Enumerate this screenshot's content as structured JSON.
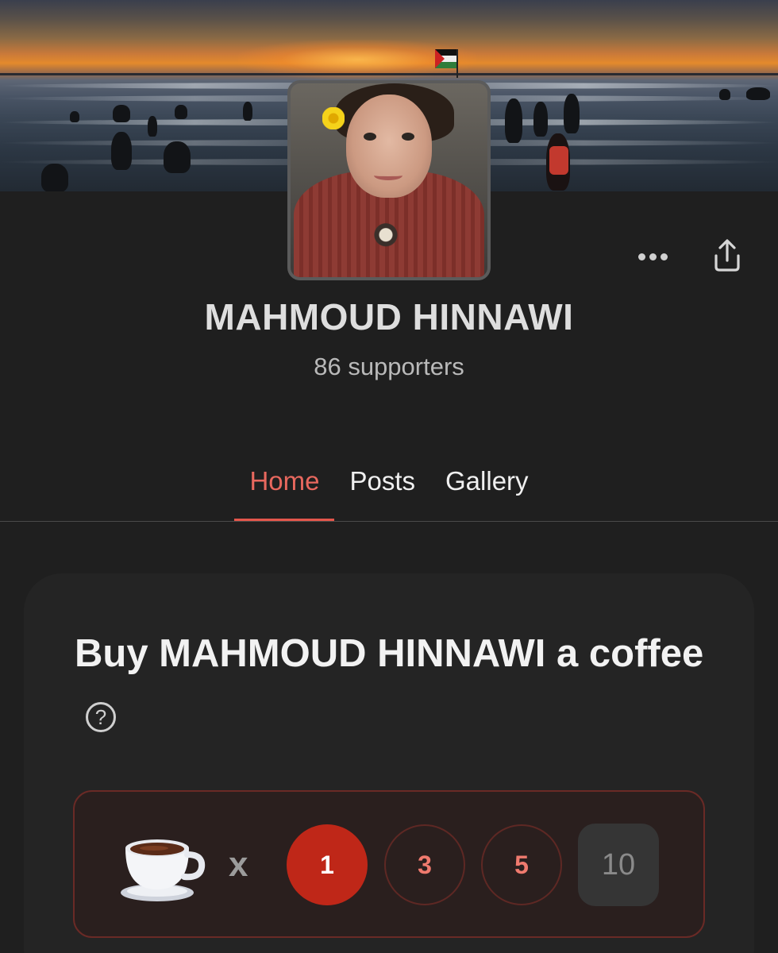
{
  "creator": {
    "name": "MAHMOUD HINNAWI",
    "supporters": "86 supporters"
  },
  "tabs": [
    {
      "label": "Home",
      "active": true
    },
    {
      "label": "Posts",
      "active": false
    },
    {
      "label": "Gallery",
      "active": false
    }
  ],
  "support": {
    "title": "Buy MAHMOUD HINNAWI a coffee",
    "help_icon": "?",
    "multiplier": "x",
    "quantity_options": [
      "1",
      "3",
      "5"
    ],
    "selected_quantity": "1",
    "custom_quantity_placeholder": "10"
  },
  "icons": {
    "more": "more-horizontal-icon",
    "share": "share-icon",
    "help": "help-circle-icon",
    "coffee": "coffee-cup-icon"
  },
  "colors": {
    "background": "#1f1f1f",
    "accent": "#e4564b",
    "selected_option": "#bf2718",
    "card": "#242424"
  }
}
